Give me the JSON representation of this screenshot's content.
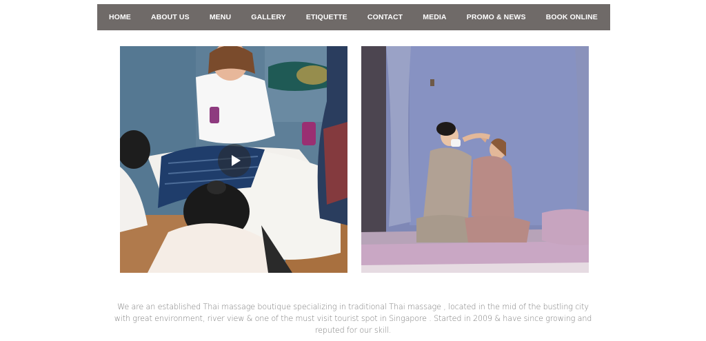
{
  "nav": {
    "items": [
      {
        "label": "HOME"
      },
      {
        "label": "ABOUT US"
      },
      {
        "label": "MENU"
      },
      {
        "label": "GALLERY"
      },
      {
        "label": "ETIQUETTE"
      },
      {
        "label": "CONTACT"
      },
      {
        "label": "MEDIA"
      },
      {
        "label": "PROMO & NEWS"
      },
      {
        "label": "BOOK ONLINE"
      }
    ],
    "background": "#6f6a68"
  },
  "media": {
    "left": {
      "type": "video",
      "icon": "play-icon"
    },
    "right": {
      "type": "image"
    }
  },
  "intro": {
    "text": "We are an established Thai massage boutique specializing in traditional Thai massage , located in the mid of the bustling city with great environment, river view & one of the must visit tourist spot in Singapore . Started in 2009 & have since growing and reputed for our skill."
  }
}
